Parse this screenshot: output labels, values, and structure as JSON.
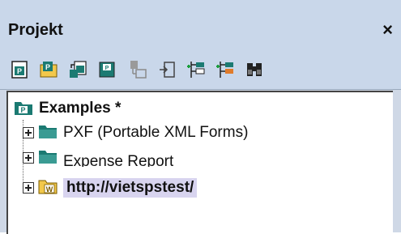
{
  "panel": {
    "title": "Projekt",
    "close_label": "×"
  },
  "toolbar": {
    "buttons": [
      {
        "icon": "new-project-icon"
      },
      {
        "icon": "open-project-icon"
      },
      {
        "icon": "reload-project-icon"
      },
      {
        "icon": "save-project-icon"
      },
      {
        "icon": "add-files-icon"
      },
      {
        "icon": "add-url-icon"
      },
      {
        "icon": "add-folder-icon"
      },
      {
        "icon": "add-external-folder-icon"
      },
      {
        "icon": "find-icon"
      }
    ]
  },
  "tree": {
    "root_label": "Examples *",
    "items": [
      {
        "label": "PXF (Portable XML Forms)"
      },
      {
        "label": "Expense Report"
      },
      {
        "label": "http://vietspstest/"
      }
    ]
  }
}
